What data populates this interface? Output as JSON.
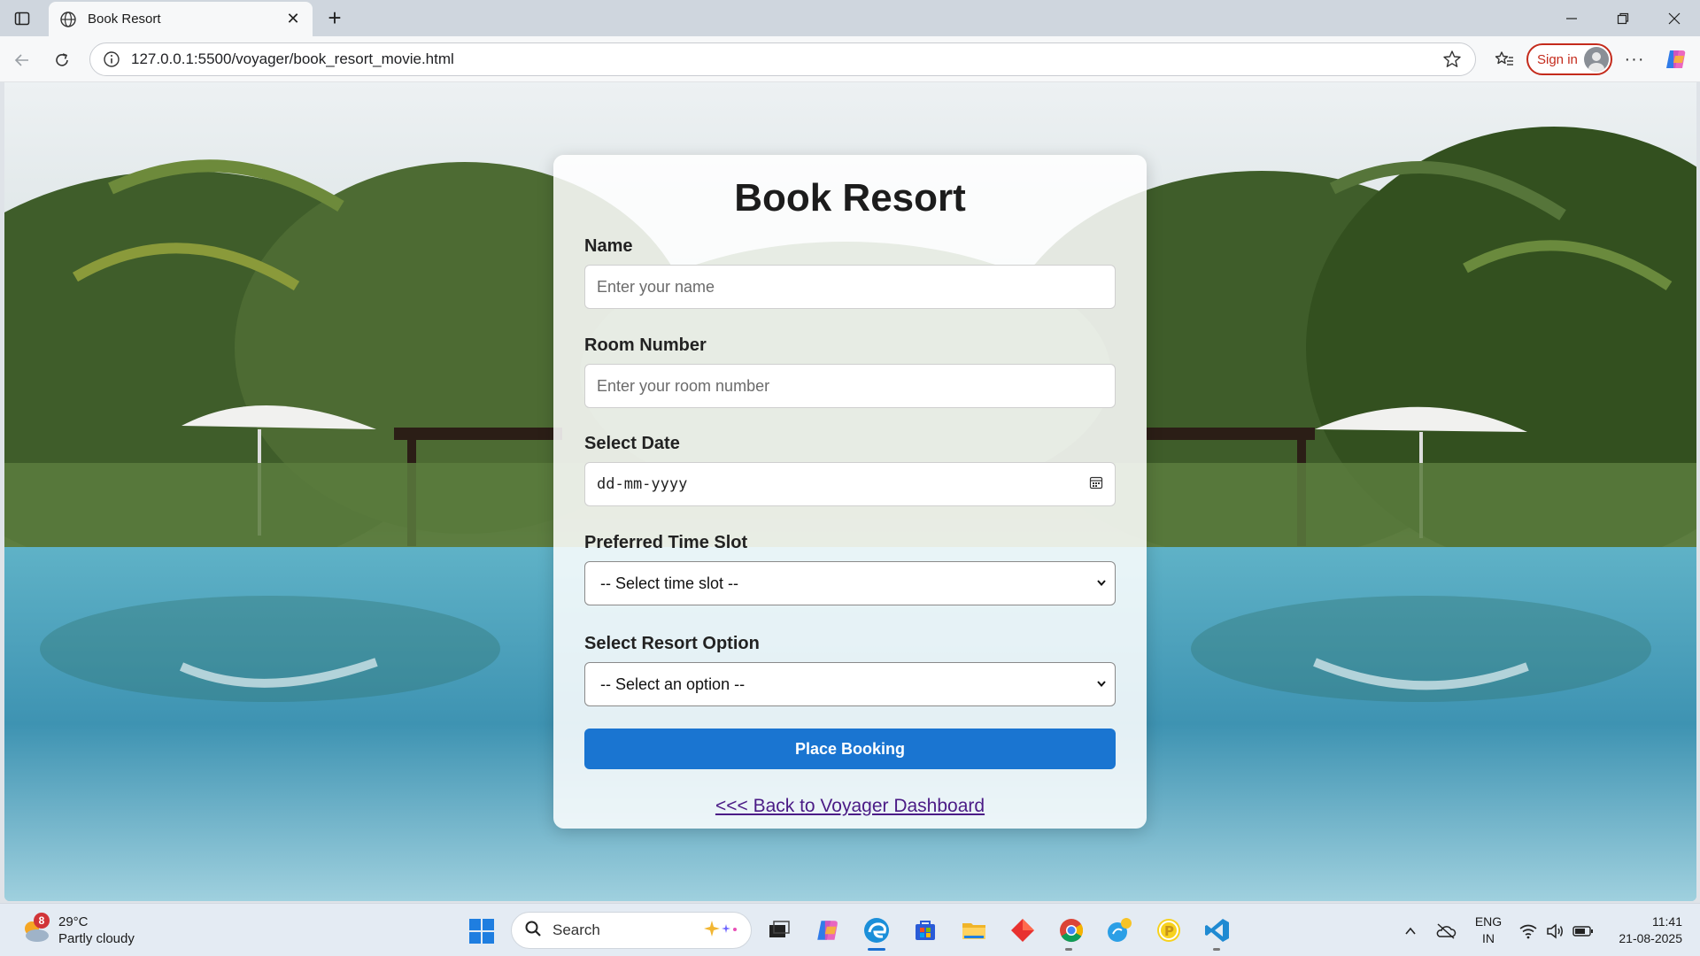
{
  "browser": {
    "tab_title": "Book Resort",
    "url": "127.0.0.1:5500/voyager/book_resort_movie.html",
    "signin_label": "Sign in"
  },
  "form": {
    "title": "Book Resort",
    "name": {
      "label": "Name",
      "placeholder": "Enter your name"
    },
    "room": {
      "label": "Room Number",
      "placeholder": "Enter your room number"
    },
    "date": {
      "label": "Select Date",
      "placeholder": "dd-mm-yyyy"
    },
    "timeslot": {
      "label": "Preferred Time Slot",
      "selected": "-- Select time slot --"
    },
    "option": {
      "label": "Select Resort Option",
      "selected": "-- Select an option --"
    },
    "submit_label": "Place Booking",
    "back_link": "<<< Back to Voyager Dashboard"
  },
  "taskbar": {
    "weather_temp": "29°C",
    "weather_desc": "Partly cloudy",
    "weather_badge": "8",
    "search_label": "Search",
    "lang_line1": "ENG",
    "lang_line2": "IN",
    "time": "11:41",
    "date": "21-08-2025"
  },
  "colors": {
    "primary_button": "#1a75d1",
    "link": "#4b1b86",
    "signin_accent": "#c42b1c"
  },
  "icons": [
    "sidebar-icon",
    "globe-icon",
    "close-icon",
    "plus-icon",
    "back-icon",
    "refresh-icon",
    "info-icon",
    "star-icon",
    "favorites-icon",
    "avatar-icon",
    "more-icon",
    "copilot-icon",
    "calendar-icon",
    "chevron-down-icon",
    "windows-start-icon",
    "search-icon",
    "weather-icon"
  ]
}
